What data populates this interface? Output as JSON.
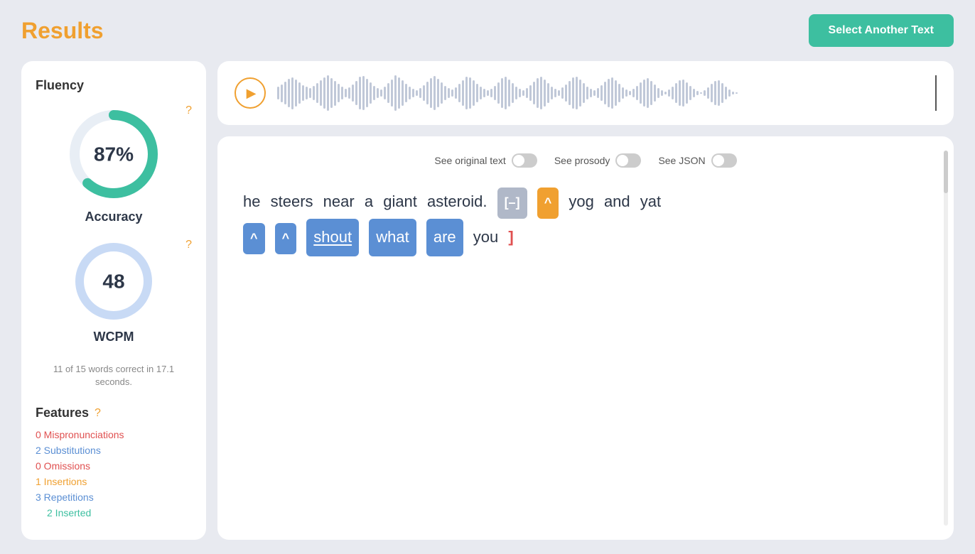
{
  "header": {
    "title": "Results",
    "select_button": "Select Another Text"
  },
  "left_panel": {
    "fluency_label": "Fluency",
    "accuracy_label": "Accuracy",
    "accuracy_value": "87%",
    "accuracy_percent": 87,
    "wcpm_label": "WCPM",
    "wcpm_value": "48",
    "wcpm_desc": "11 of 15 words correct\nin 17.1 seconds.",
    "features_label": "Features",
    "features": [
      {
        "text": "0 Mispronunciations",
        "style": "zero"
      },
      {
        "text": "2 Substitutions",
        "style": "nonzero"
      },
      {
        "text": "0 Omissions",
        "style": "zero"
      },
      {
        "text": "1 Insertions",
        "style": "orange"
      },
      {
        "text": "3 Repetitions",
        "style": "nonzero"
      },
      {
        "text": "2 Inserted",
        "style": "green"
      }
    ]
  },
  "toggles": [
    {
      "label": "See original text",
      "on": false
    },
    {
      "label": "See prosody",
      "on": false
    },
    {
      "label": "See JSON",
      "on": false
    }
  ],
  "reading_text": {
    "words": [
      {
        "text": "he",
        "type": "normal"
      },
      {
        "text": "steers",
        "type": "normal"
      },
      {
        "text": "near",
        "type": "normal"
      },
      {
        "text": "a",
        "type": "normal"
      },
      {
        "text": "giant",
        "type": "normal"
      },
      {
        "text": "asteroid.",
        "type": "normal"
      },
      {
        "text": "[–]",
        "type": "omission"
      },
      {
        "text": "^",
        "type": "insertion"
      },
      {
        "text": "yog",
        "type": "normal"
      },
      {
        "text": "and",
        "type": "normal"
      },
      {
        "text": "yat",
        "type": "normal"
      },
      {
        "text": "^",
        "type": "insertion_blue"
      },
      {
        "text": "^",
        "type": "insertion_blue"
      },
      {
        "text": "shout",
        "type": "substitution_underline"
      },
      {
        "text": "what",
        "type": "substitution_blue"
      },
      {
        "text": "are",
        "type": "substitution_blue"
      },
      {
        "text": "you",
        "type": "normal"
      },
      {
        "text": "]",
        "type": "bracket"
      }
    ]
  }
}
